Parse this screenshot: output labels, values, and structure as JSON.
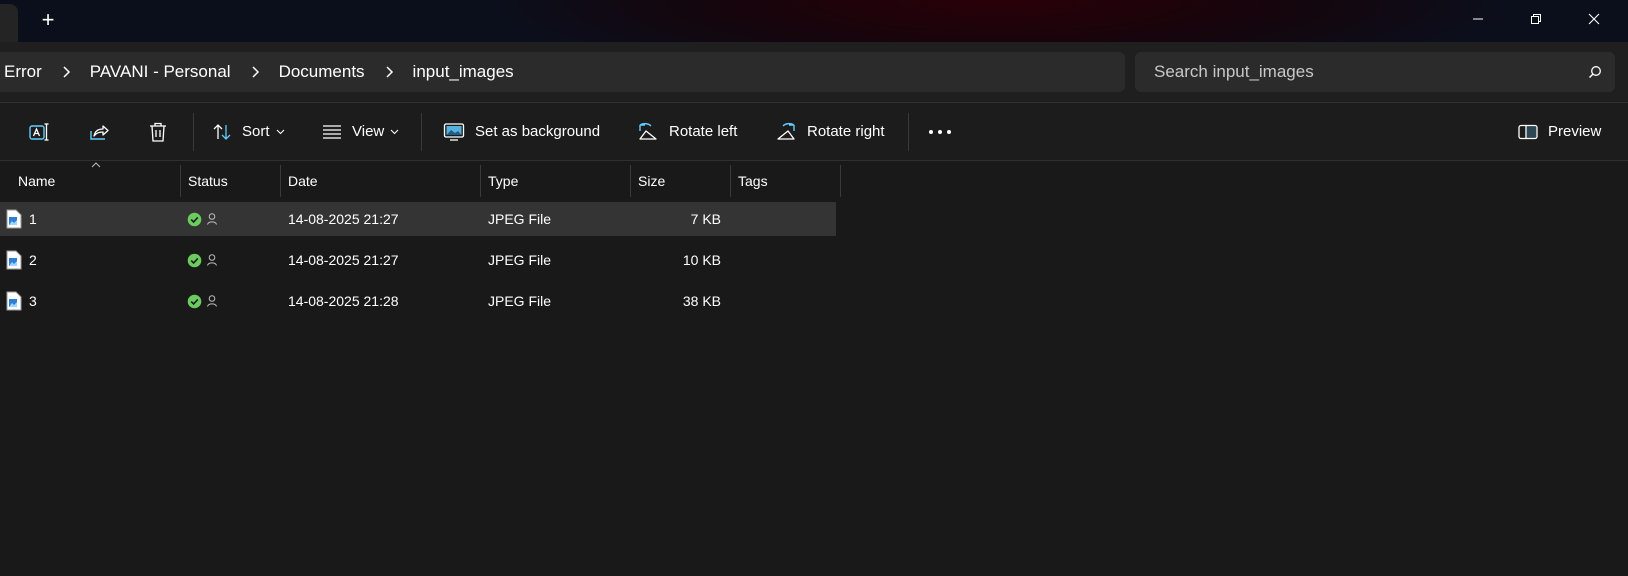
{
  "titlebar": {
    "new_tab_glyph": "+",
    "controls": [
      "minimize-icon",
      "restore-icon",
      "close-icon"
    ]
  },
  "breadcrumb": {
    "items": [
      "Error",
      "PAVANI - Personal",
      "Documents",
      "input_images"
    ]
  },
  "search": {
    "placeholder": "Search input_images"
  },
  "toolbar": {
    "sort_label": "Sort",
    "view_label": "View",
    "set_background_label": "Set as background",
    "rotate_left_label": "Rotate left",
    "rotate_right_label": "Rotate right",
    "preview_label": "Preview",
    "icons": [
      "rename-icon",
      "share-icon",
      "delete-icon",
      "sort-icon",
      "view-icon",
      "set-background-icon",
      "rotate-left-icon",
      "rotate-right-icon",
      "more-icon",
      "preview-pane-icon"
    ]
  },
  "columns": [
    "Name",
    "Status",
    "Date",
    "Type",
    "Size",
    "Tags"
  ],
  "files": [
    {
      "name": "1",
      "date": "14-08-2025 21:27",
      "type": "JPEG File",
      "size": "7 KB",
      "tags": "",
      "selected": true
    },
    {
      "name": "2",
      "date": "14-08-2025 21:27",
      "type": "JPEG File",
      "size": "10 KB",
      "tags": "",
      "selected": false
    },
    {
      "name": "3",
      "date": "14-08-2025 21:28",
      "type": "JPEG File",
      "size": "38 KB",
      "tags": "",
      "selected": false
    }
  ],
  "colors": {
    "background": "#191919",
    "status_synced": "#6ccb5f",
    "accent_icon": "#60cdff"
  }
}
